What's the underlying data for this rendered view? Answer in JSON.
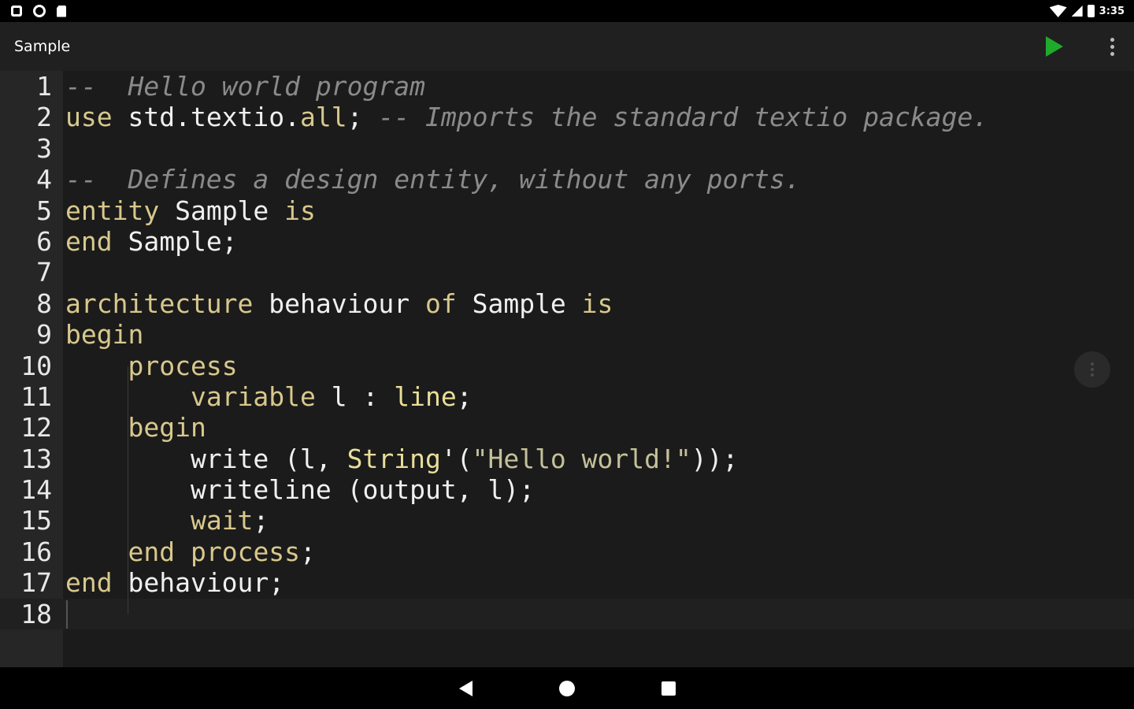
{
  "status_bar": {
    "left_icons": [
      "notification-icon",
      "settings-sync-icon",
      "sd-card-icon"
    ],
    "right_icons": [
      "wifi-icon",
      "signal-icon",
      "battery-icon"
    ],
    "time": "3:35"
  },
  "app_bar": {
    "title": "Sample",
    "actions": [
      "play-icon",
      "more-vert-icon"
    ]
  },
  "editor": {
    "current_line": 18,
    "lines": [
      {
        "n": "1",
        "seg": [
          [
            "c",
            "--  Hello world program"
          ]
        ]
      },
      {
        "n": "2",
        "seg": [
          [
            "k",
            "use"
          ],
          [
            "p",
            " std.textio."
          ],
          [
            "k",
            "all"
          ],
          [
            "p",
            "; "
          ],
          [
            "c",
            "-- Imports the standard textio package."
          ]
        ]
      },
      {
        "n": "3",
        "seg": []
      },
      {
        "n": "4",
        "seg": [
          [
            "c",
            "--  Defines a design entity, without any ports."
          ]
        ]
      },
      {
        "n": "5",
        "seg": [
          [
            "k",
            "entity"
          ],
          [
            "p",
            " Sample "
          ],
          [
            "k",
            "is"
          ]
        ]
      },
      {
        "n": "6",
        "seg": [
          [
            "k",
            "end"
          ],
          [
            "p",
            " Sample;"
          ]
        ]
      },
      {
        "n": "7",
        "seg": []
      },
      {
        "n": "8",
        "seg": [
          [
            "k",
            "architecture"
          ],
          [
            "p",
            " behaviour "
          ],
          [
            "k",
            "of"
          ],
          [
            "p",
            " Sample "
          ],
          [
            "k",
            "is"
          ]
        ]
      },
      {
        "n": "9",
        "seg": [
          [
            "k",
            "begin"
          ]
        ]
      },
      {
        "n": "10",
        "seg": [
          [
            "p",
            "    "
          ],
          [
            "k",
            "process"
          ]
        ]
      },
      {
        "n": "11",
        "seg": [
          [
            "p",
            "        "
          ],
          [
            "k",
            "variable"
          ],
          [
            "p",
            " l : "
          ],
          [
            "t",
            "line"
          ],
          [
            "p",
            ";"
          ]
        ]
      },
      {
        "n": "12",
        "seg": [
          [
            "p",
            "    "
          ],
          [
            "k",
            "begin"
          ]
        ]
      },
      {
        "n": "13",
        "seg": [
          [
            "p",
            "        write (l, "
          ],
          [
            "t",
            "String"
          ],
          [
            "p",
            "'("
          ],
          [
            "s",
            "\"Hello world!\""
          ],
          [
            "p",
            "));"
          ]
        ]
      },
      {
        "n": "14",
        "seg": [
          [
            "p",
            "        writeline (output, l);"
          ]
        ]
      },
      {
        "n": "15",
        "seg": [
          [
            "p",
            "        "
          ],
          [
            "k",
            "wait"
          ],
          [
            "p",
            ";"
          ]
        ]
      },
      {
        "n": "16",
        "seg": [
          [
            "p",
            "    "
          ],
          [
            "k",
            "end"
          ],
          [
            "p",
            " "
          ],
          [
            "k",
            "process"
          ],
          [
            "p",
            ";"
          ]
        ]
      },
      {
        "n": "17",
        "seg": [
          [
            "k",
            "end"
          ],
          [
            "p",
            " behaviour;"
          ]
        ]
      },
      {
        "n": "18",
        "seg": []
      }
    ]
  },
  "floating_button": {
    "icon": "more-vert-icon"
  },
  "nav_bar": {
    "buttons": [
      "back-icon",
      "home-icon",
      "recents-icon"
    ]
  },
  "colors": {
    "keyword": "#d8c88c",
    "comment": "#8a8a8a",
    "string": "#c4c09a",
    "type": "#e8de98",
    "plain": "#f0f0f0",
    "run_accent": "#1faa2c",
    "editor_background": "#1b1b1b",
    "gutter_background": "#262626"
  }
}
